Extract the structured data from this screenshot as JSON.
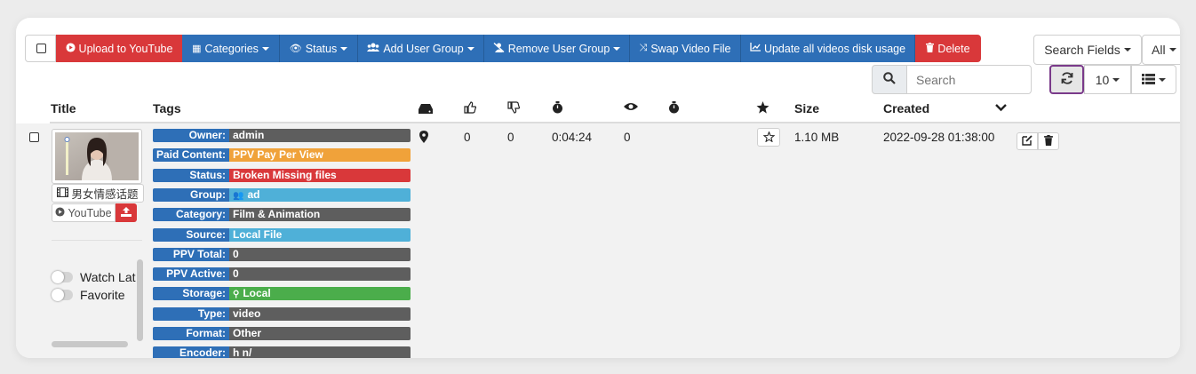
{
  "toolbar": {
    "upload_youtube": "Upload to YouTube",
    "categories": "Categories",
    "status": "Status",
    "add_user_group": "Add User Group",
    "remove_user_group": "Remove User Group",
    "swap_video_file": "Swap Video File",
    "update_disk_usage": "Update all videos disk usage",
    "delete": "Delete"
  },
  "controls": {
    "search_fields": "Search Fields",
    "all_filter": "All",
    "search_placeholder": "Search",
    "page_size": "10"
  },
  "columns": {
    "title": "Title",
    "tags": "Tags",
    "size": "Size",
    "created": "Created"
  },
  "row": {
    "video_title": "男女情感话题",
    "youtube_label": "YouTube",
    "likes": "0",
    "dislikes": "0",
    "duration": "0:04:24",
    "views": "0",
    "size": "1.10 MB",
    "created": "2022-09-28 01:38:00",
    "watch_later": "Watch Lat",
    "favorite": "Favorite",
    "tags": [
      {
        "key": "Owner:",
        "value": "admin",
        "color": "#5e5e5e"
      },
      {
        "key": "Paid Content:",
        "value": "PPV Pay Per View",
        "color": "#f0a23a"
      },
      {
        "key": "Status:",
        "value": "Broken Missing files",
        "color": "#d9383a"
      },
      {
        "key": "Group:",
        "value": "ad",
        "color": "#4fb0d8"
      },
      {
        "key": "Category:",
        "value": "Film & Animation",
        "color": "#5e5e5e"
      },
      {
        "key": "Source:",
        "value": "Local File",
        "color": "#4fb0d8"
      },
      {
        "key": "PPV Total:",
        "value": "0",
        "color": "#5e5e5e"
      },
      {
        "key": "PPV Active:",
        "value": "0",
        "color": "#5e5e5e"
      },
      {
        "key": "Storage:",
        "value": "Local",
        "color": "#4bad4b"
      },
      {
        "key": "Type:",
        "value": "video",
        "color": "#5e5e5e"
      },
      {
        "key": "Format:",
        "value": "Other",
        "color": "#5e5e5e"
      },
      {
        "key": "Encoder:",
        "value": "h                                  n/",
        "color": "#5e5e5e"
      }
    ]
  }
}
